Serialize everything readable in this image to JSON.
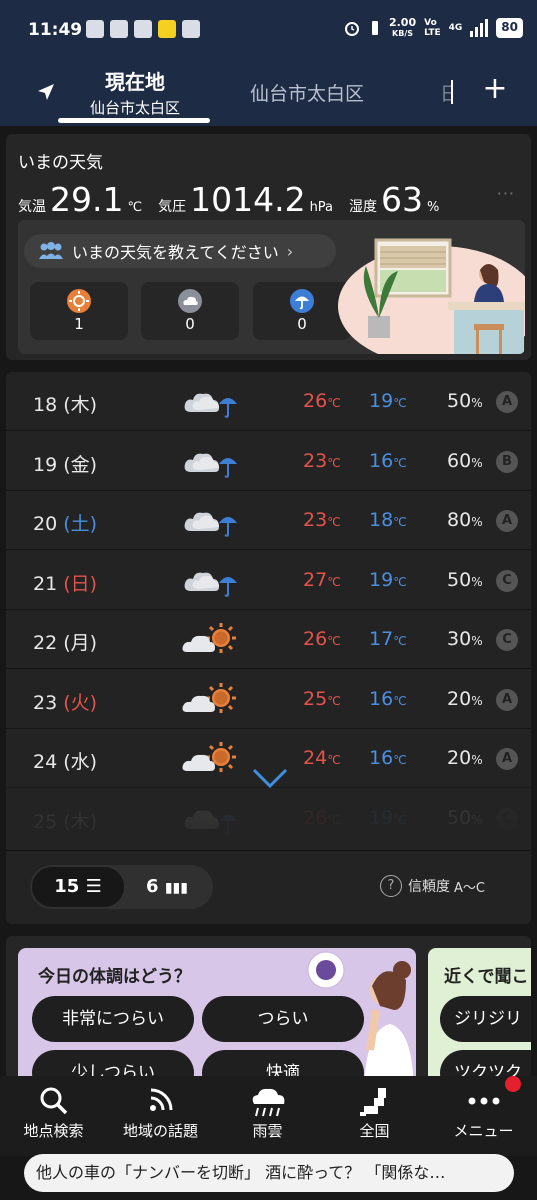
{
  "status_bar": {
    "time": "11:49",
    "net_speed": "2.00",
    "net_unit": "KB/S",
    "volte_top": "Vo",
    "volte_bottom": "LTE",
    "network": "4G",
    "battery": "80"
  },
  "location_tabs": {
    "current_title": "現在地",
    "current_subtitle": "仙台市太白区",
    "other_location": "仙台市太白区",
    "add_label": "+"
  },
  "current_weather": {
    "title": "いまの天気",
    "temp_label": "気温",
    "temp_value": "29.1",
    "temp_unit": "℃",
    "pressure_label": "気圧",
    "pressure_value": "1014.2",
    "pressure_unit": "hPa",
    "humidity_label": "湿度",
    "humidity_value": "63",
    "humidity_unit": "%",
    "more_label": "···",
    "ask_prompt": "いまの天気を教えてください",
    "votes": [
      {
        "icon": "sun-icon",
        "count": "1"
      },
      {
        "icon": "cloud-icon",
        "count": "0"
      },
      {
        "icon": "umbrella-icon",
        "count": "0"
      }
    ]
  },
  "forecast": {
    "rows": [
      {
        "day": "18",
        "weekday": "(木)",
        "weekday_type": "normal",
        "icon": "cloud-umbrella-icon",
        "high": "26",
        "low": "19",
        "pop": "50",
        "reliability": "A"
      },
      {
        "day": "19",
        "weekday": "(金)",
        "weekday_type": "normal",
        "icon": "cloud-umbrella-icon",
        "high": "23",
        "low": "16",
        "pop": "60",
        "reliability": "B"
      },
      {
        "day": "20",
        "weekday": "(土)",
        "weekday_type": "sat",
        "icon": "cloud-umbrella-icon",
        "high": "23",
        "low": "18",
        "pop": "80",
        "reliability": "A"
      },
      {
        "day": "21",
        "weekday": "(日)",
        "weekday_type": "hol",
        "icon": "cloud-umbrella-icon",
        "high": "27",
        "low": "19",
        "pop": "50",
        "reliability": "C"
      },
      {
        "day": "22",
        "weekday": "(月)",
        "weekday_type": "normal",
        "icon": "cloud-sun-icon",
        "high": "26",
        "low": "17",
        "pop": "30",
        "reliability": "C"
      },
      {
        "day": "23",
        "weekday": "(火)",
        "weekday_type": "hol",
        "icon": "cloud-sun-icon",
        "high": "25",
        "low": "16",
        "pop": "20",
        "reliability": "A"
      },
      {
        "day": "24",
        "weekday": "(水)",
        "weekday_type": "normal",
        "icon": "cloud-sun-icon",
        "high": "24",
        "low": "16",
        "pop": "20",
        "reliability": "A"
      },
      {
        "day": "25",
        "weekday": "(木)",
        "weekday_type": "normal",
        "icon": "cloud-umbrella-icon",
        "high": "26",
        "low": "19",
        "pop": "50",
        "reliability": "C"
      }
    ],
    "temp_unit": "℃",
    "pop_unit": "%",
    "days_15": "15",
    "days_6": "6",
    "reliability_label": "信頼度",
    "reliability_range": "A〜C",
    "reliability_q": "?"
  },
  "topics": {
    "card1_question": "今日の体調はどう？",
    "chips": [
      "非常につらい",
      "つらい",
      "少しつらい",
      "快適"
    ],
    "card2_question": "近くで聞こ",
    "card2_chips": [
      "ジリジリ",
      "ツクツク"
    ]
  },
  "bottom_nav": {
    "items": [
      {
        "label": "地点検索",
        "icon": "search-icon"
      },
      {
        "label": "地域の話題",
        "icon": "rss-icon"
      },
      {
        "label": "雨雲",
        "icon": "rain-cloud-icon"
      },
      {
        "label": "全国",
        "icon": "japan-map-icon"
      },
      {
        "label": "メニュー",
        "icon": "more-dots-icon"
      }
    ]
  },
  "news_ticker": "他人の車の「ナンバーを切断」 酒に酔って？ 「関係な…",
  "colors": {
    "header_bg": "#1d2b44",
    "high_temp": "#e5534b",
    "low_temp": "#4a90e2",
    "badge": "#e5202e"
  }
}
